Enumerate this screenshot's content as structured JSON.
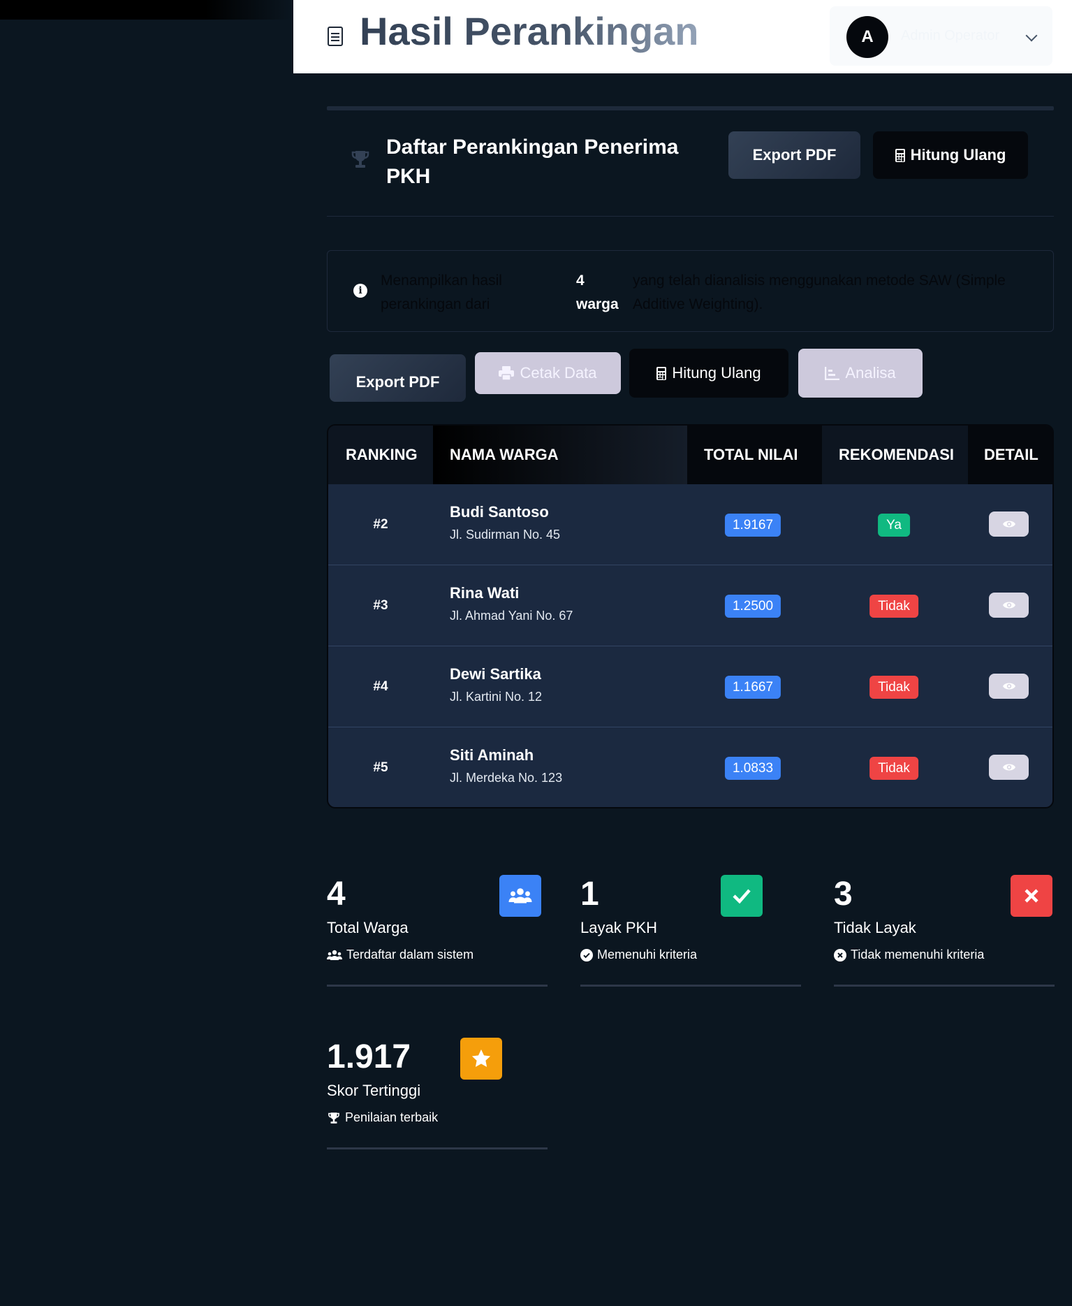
{
  "header": {
    "title": "Hasil Perankingan",
    "user_initial": "A",
    "user_name": "Admin Operator"
  },
  "card": {
    "title": "Daftar Perankingan Penerima PKH",
    "export_label": "Export PDF",
    "recalc_label": "Hitung Ulang"
  },
  "info": {
    "text_before": "Menampilkan hasil perankingan dari",
    "count": "4 warga",
    "text_after": "yang telah dianalisis menggunakan metode SAW (Simple Additive Weighting)."
  },
  "actions": {
    "export": "Export PDF",
    "print": "Cetak Data",
    "recalc": "Hitung Ulang",
    "analysis": "Analisa"
  },
  "table": {
    "columns": [
      "RANKING",
      "NAMA WARGA",
      "TOTAL NILAI",
      "REKOMENDASI",
      "DETAIL"
    ],
    "rows": [
      {
        "rank": "#2",
        "name": "Budi Santoso",
        "address": "Jl. Sudirman No. 45",
        "score": "1.9167",
        "recommendation": "Ya"
      },
      {
        "rank": "#3",
        "name": "Rina Wati",
        "address": "Jl. Ahmad Yani No. 67",
        "score": "1.2500",
        "recommendation": "Tidak"
      },
      {
        "rank": "#4",
        "name": "Dewi Sartika",
        "address": "Jl. Kartini No. 12",
        "score": "1.1667",
        "recommendation": "Tidak"
      },
      {
        "rank": "#5",
        "name": "Siti Aminah",
        "address": "Jl. Merdeka No. 123",
        "score": "1.0833",
        "recommendation": "Tidak"
      }
    ]
  },
  "stats": [
    {
      "value": "4",
      "label": "Total Warga",
      "sub": "Terdaftar dalam sistem",
      "color": "#3b82f6",
      "icon": "users-icon"
    },
    {
      "value": "1",
      "label": "Layak PKH",
      "sub": "Memenuhi kriteria",
      "color": "#10b981",
      "icon": "check-icon"
    },
    {
      "value": "3",
      "label": "Tidak Layak",
      "sub": "Tidak memenuhi kriteria",
      "color": "#ef4444",
      "icon": "x-icon"
    },
    {
      "value": "1.917",
      "label": "Skor Tertinggi",
      "sub": "Penilaian terbaik",
      "color": "#f59e0b",
      "icon": "star-icon"
    }
  ]
}
